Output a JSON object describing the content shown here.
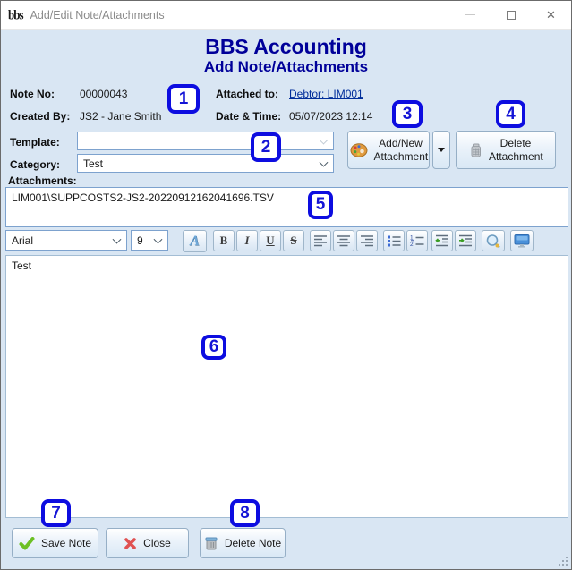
{
  "colors": {
    "heading": "#000099",
    "annotation_blue": "#0d0de0",
    "body_background": "#d9e6f3",
    "link": "#002d9a"
  },
  "window": {
    "title": "Add/Edit Note/Attachments",
    "logo_text": "bbs"
  },
  "header": {
    "title": "BBS Accounting",
    "subtitle": "Add Note/Attachments"
  },
  "info": {
    "note_no_label": "Note No:",
    "note_no_value": "00000043",
    "attached_to_label": "Attached to:",
    "attached_to_value": "Debtor: LIM001",
    "created_by_label": "Created By:",
    "created_by_value": "JS2 - Jane Smith",
    "datetime_label": "Date & Time:",
    "datetime_value": "05/07/2023 12:14"
  },
  "template": {
    "label": "Template:",
    "value": ""
  },
  "category": {
    "label": "Category:",
    "value": "Test"
  },
  "attachment_actions": {
    "add_label": "Add/New Attachment",
    "delete_label": "Delete Attachment"
  },
  "attachments": {
    "label": "Attachments:",
    "items": [
      "LIM001\\SUPPCOSTS2-JS2-20220912162041696.TSV"
    ]
  },
  "editor": {
    "font_name": "Arial",
    "font_size": "9",
    "buttons": {
      "font_color": "A",
      "bold": "B",
      "italic": "I",
      "underline": "U",
      "strikethrough": "S"
    },
    "content": "Test"
  },
  "footer": {
    "save_label": "Save Note",
    "close_label": "Close",
    "delete_label": "Delete Note"
  },
  "annotations": [
    "1",
    "2",
    "3",
    "4",
    "5",
    "6",
    "7",
    "8"
  ]
}
